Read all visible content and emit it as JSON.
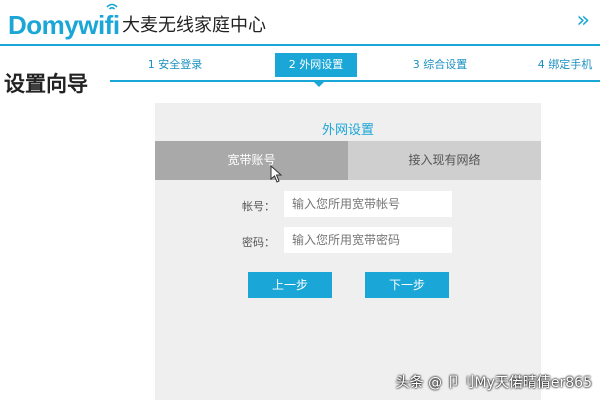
{
  "header": {
    "logo_text": "Domywifi",
    "app_title": "大麦无线家庭中心",
    "chevron": "»"
  },
  "page_title": "设置向导",
  "steps": [
    {
      "label": "1 安全登录",
      "active": false
    },
    {
      "label": "2 外网设置",
      "active": true
    },
    {
      "label": "3 综合设置",
      "active": false
    },
    {
      "label": "4 绑定手机",
      "active": false
    }
  ],
  "panel": {
    "title": "外网设置",
    "tabs": [
      {
        "label": "宽带账号",
        "active": true
      },
      {
        "label": "接入现有网络",
        "active": false
      }
    ],
    "fields": {
      "account_label": "帐号：",
      "account_placeholder": "输入您所用宽带帐号",
      "password_label": "密码：",
      "password_placeholder": "输入您所用宽带密码"
    },
    "prev_button": "上一步",
    "next_button": "下一步"
  },
  "watermark": "头条 @ 卩刂My天偌晴倩er865",
  "colors": {
    "accent": "#1aa6d6",
    "tab_active": "#a9a9a9",
    "tab_inactive": "#cfcfcf",
    "panel_bg": "#efefef"
  }
}
